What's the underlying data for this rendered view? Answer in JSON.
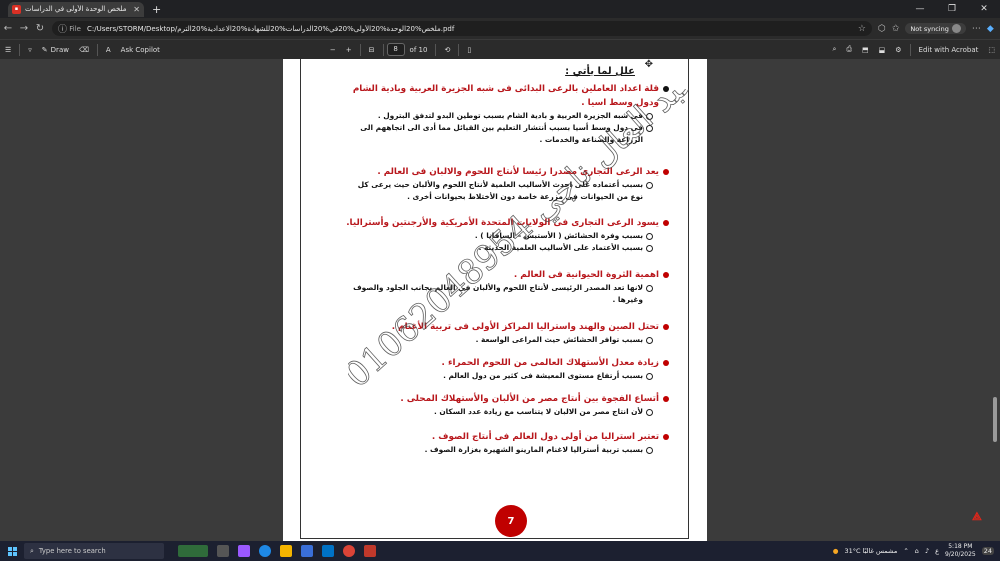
{
  "browser": {
    "tab_title": "ملخص الوحدة الأولى في الدراسات",
    "new_tab": "+",
    "file_label": "File",
    "url": "C:/Users/STORM/Desktop/ملخص%20الوحدة%20الأولى%20في%20الدراسات%20للشهادة%20الاعدادية%20الترم.pdf",
    "sync_label": "Not syncing",
    "window_controls": [
      "—",
      "❐",
      "✕"
    ]
  },
  "pdf_toolbar": {
    "draw_label": "Draw",
    "copilot_label": "Ask Copilot",
    "zoom_minus": "−",
    "zoom_plus": "+",
    "page_current": "8",
    "page_total": "of 10",
    "edit_label": "Edit with Acrobat"
  },
  "document": {
    "heading": "علل لما يأتي :",
    "watermark": "01062048954 عبد العال ناجي",
    "page_number": "7",
    "items": [
      {
        "q": "قلة اعداد العاملين بالرعى البدائى فى شبه الجزيرة العربية وبادية الشام ودول وسط اسيا .",
        "black": true,
        "a": [
          "فى شبه الجزيرة العربية و بادية الشام  بسبب توطين البدو لتدفق البترول .",
          "فى دول وسط أسيا بسبب أنتشار التعليم بين القبائل مما أدى الى اتجاههم الى الزراعة والصناعة والخدمات ."
        ]
      },
      {
        "q": "يعد الرعى التجارى مصدرا رئيسا لأنتاج اللحوم والالبان فى العالم .",
        "black": false,
        "a": [
          "بسبب أعتماده على احدث الأساليب العلمية لأنتاج اللحوم والألبان حيث يرعى كل نوع من الحيوانات فى مزرعة خاصة دون الأختلاط بحيوانات أخرى ."
        ]
      },
      {
        "q": "يسود الرعى التجارى فى الولايات المتحدة الأمريكية والأرجنتين وأستراليا.",
        "black": false,
        "a": [
          "بسبب وفرة الحشائش ( الأستبس – السافانا ) .",
          "بسبب الأعتماد على الأساليب العلمية الحديثة ."
        ]
      },
      {
        "q": "اهمية الثروة الحيوانية فى العالم .",
        "black": false,
        "a": [
          "لانها تعد المصدر الرئيسى لأنتاج اللحوم والألبان فى العالم بجانب الجلود والصوف وغيرها ."
        ]
      },
      {
        "q": "تحتل الصين والهند واستراليا المراكز الأولى فى تربية الأغنام .",
        "black": false,
        "a": [
          "بسبب توافر الحشائش حيث المراعى الواسعة ."
        ]
      },
      {
        "q": "زيادة معدل الأستهلاك العالمى من اللحوم الحمراء .",
        "black": false,
        "a": [
          "بسبب أرتفاع مستوى المعيشة فى كثير من دول العالم ."
        ]
      },
      {
        "q": "أتساع الفجوة بين أنتاج مصر من الألبان والأستهلاك المحلى .",
        "black": false,
        "a": [
          "لأن انتاج مصر من الالبان لا يتناسب مع زيادة عدد السكان ."
        ]
      },
      {
        "q": "تعتبر استراليا من أولى دول العالم فى أنتاج الصوف .",
        "black": false,
        "a": [
          "بسبب تربية أستراليا لاغنام المارينو الشهيرة بغزارة الصوف ."
        ]
      }
    ]
  },
  "taskbar": {
    "search_placeholder": "Type here to search",
    "weather": "31°C  مشمس غالبًا",
    "time": "5:18 PM",
    "date": "9/20/2025",
    "notif": "24"
  },
  "colors": {
    "question_red": "#b8171c",
    "page_badge": "#c00000",
    "viewer_bg": "#3b3b3b"
  }
}
